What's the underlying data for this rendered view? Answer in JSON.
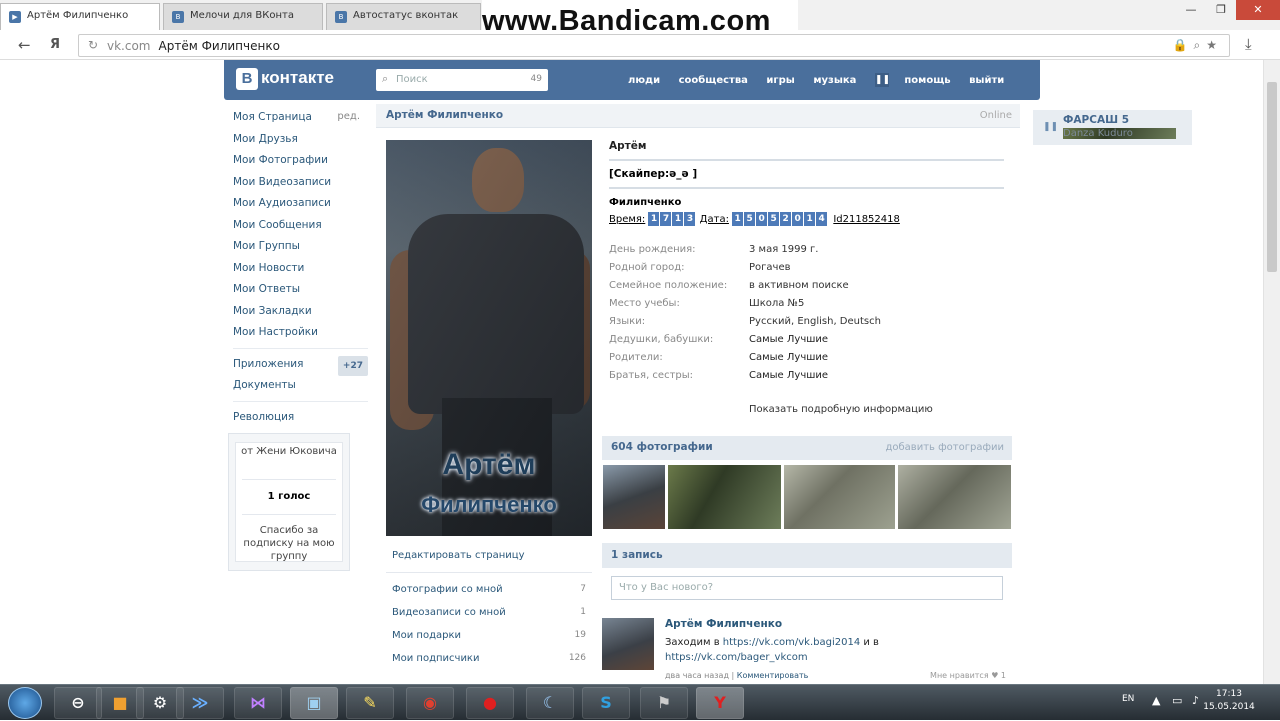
{
  "browser": {
    "tabs": [
      "Артём Филипченко",
      "Мелочи для ВКонта",
      "Автостатус вконтак"
    ],
    "url_host": "vk.com",
    "url_title": "Артём Филипченко",
    "watermark": "www.Bandicam.com",
    "back_glyph": "←",
    "yandex_glyph": "Я"
  },
  "vk_header": {
    "logo": "контакте",
    "logo_b": "В",
    "search_placeholder": "Поиск",
    "search_count": "49",
    "menu": [
      "люди",
      "сообщества",
      "игры",
      "музыка",
      "помощь",
      "выйти"
    ]
  },
  "left_nav": {
    "items": [
      "Моя Страница",
      "Мои Друзья",
      "Мои Фотографии",
      "Мои Видеозаписи",
      "Мои Аудиозаписи",
      "Мои Сообщения",
      "Мои Группы",
      "Мои Новости",
      "Мои Ответы",
      "Мои Закладки",
      "Мои Настройки"
    ],
    "edit": "ред.",
    "apps": "Приложения",
    "apps_badge": "+27",
    "docs": "Документы",
    "extra": "Революция"
  },
  "poll": {
    "from": "от Жени Юковича",
    "votes": "1 голос",
    "note": "Спасибо за подписку на мою группу"
  },
  "profile": {
    "header_name": "Артём Филипченко",
    "header_status": "Online",
    "photo_caption_1": "Артём",
    "photo_caption_2": "Филипченко",
    "first_name": "Артём",
    "status": "[Скайпер:ә_ә ]",
    "surname": "Филипченко",
    "time_label": "Время:",
    "time_digits": [
      "1",
      "7",
      "1",
      "3"
    ],
    "date_label": "Дата:",
    "date_digits": [
      "1",
      "5",
      "0",
      "5",
      "2",
      "0",
      "1",
      "4"
    ],
    "id": "Id211852418",
    "info": [
      {
        "k": "День рождения:",
        "v": "3 мая 1999 г."
      },
      {
        "k": "Родной город:",
        "v": "Рогачев"
      },
      {
        "k": "Семейное положение:",
        "v": "в активном поиске"
      },
      {
        "k": "Место учебы:",
        "v": "Школа №5"
      },
      {
        "k": "Языки:",
        "v": "Русский, English, Deutsch"
      },
      {
        "k": "Дедушки, бабушки:",
        "v": "Самые Лучшие"
      },
      {
        "k": "Родители:",
        "v": "Самые Лучшие"
      },
      {
        "k": "Братья, сестры:",
        "v": "Самые Лучшие"
      }
    ],
    "more_info": "Показать подробную информацию",
    "edit_page": "Редактировать страницу",
    "sublist": [
      {
        "label": "Фотографии со мной",
        "n": "7"
      },
      {
        "label": "Видеозаписи со мной",
        "n": "1"
      },
      {
        "label": "Мои подарки",
        "n": "19"
      },
      {
        "label": "Мои подписчики",
        "n": "126"
      }
    ],
    "photos_title": "604 фотографии",
    "photos_add": "добавить фотографии",
    "wall_title": "1 запись",
    "post_placeholder": "Что у Вас нового?",
    "post": {
      "author": "Артём Филипченко",
      "text_pre": "Заходим в ",
      "link1": "https://vk.com/vk.bagi2014",
      "text_mid": " и в ",
      "link2": "https://vk.com/bager_vkcom",
      "time": "два часа назад",
      "comment": "Комментировать",
      "likes": "Мне нравится",
      "like_count": "1"
    }
  },
  "audio": {
    "title": "ФАРСАШ 5",
    "artist": "Danza Kuduro"
  },
  "taskbar": {
    "lang": "EN",
    "time": "17:13",
    "date": "15.05.2014"
  }
}
